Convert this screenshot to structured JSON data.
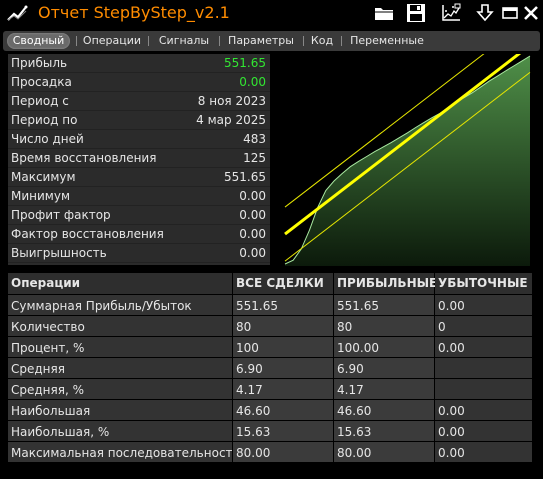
{
  "window": {
    "title": "Отчет StepByStep_v2.1",
    "icons": [
      "folder-icon",
      "save-icon",
      "chart-export-icon",
      "download-icon",
      "minimize-icon",
      "close-icon"
    ]
  },
  "tabs": [
    {
      "label": "Сводный",
      "active": true
    },
    {
      "label": "Операции",
      "active": false
    },
    {
      "label": "Сигналы",
      "active": false
    },
    {
      "label": "Параметры",
      "active": false
    },
    {
      "label": "Код",
      "active": false
    },
    {
      "label": "Переменные",
      "active": false
    }
  ],
  "stats": [
    {
      "label": "Прибыль",
      "value": "551.65",
      "color": "#32e632"
    },
    {
      "label": "Просадка",
      "value": "0.00",
      "color": "#32e632"
    },
    {
      "label": "Период с",
      "value": "8 ноя 2023"
    },
    {
      "label": "Период по",
      "value": "4 мар 2025"
    },
    {
      "label": "Число дней",
      "value": "483"
    },
    {
      "label": "Время восстановления",
      "value": "125"
    },
    {
      "label": "Максимум",
      "value": "551.65"
    },
    {
      "label": "Минимум",
      "value": "0.00"
    },
    {
      "label": "Профит фактор",
      "value": "0.00"
    },
    {
      "label": "Фактор восстановления",
      "value": "0.00"
    },
    {
      "label": "Выигрышность",
      "value": "0.00"
    }
  ],
  "table": {
    "headers": [
      "Операции",
      "ВСЕ СДЕЛКИ",
      "ПРИБЫЛЬНЫЕ",
      "УБЫТОЧНЫЕ"
    ],
    "rows": [
      [
        "Суммарная Прибыль/Убыток",
        "551.65",
        "551.65",
        "0.00"
      ],
      [
        "Количество",
        "80",
        "80",
        "0"
      ],
      [
        "Процент, %",
        "100",
        "100.00",
        "0.00"
      ],
      [
        "Средняя",
        "6.90",
        "6.90",
        ""
      ],
      [
        "Средняя, %",
        "4.17",
        "4.17",
        ""
      ],
      [
        "Наибольшая",
        "46.60",
        "46.60",
        "0.00"
      ],
      [
        "Наибольшая, %",
        "15.63",
        "15.63",
        "0.00"
      ],
      [
        "Максимальная последовательность",
        "80.00",
        "80.00",
        "0.00"
      ]
    ]
  },
  "chart_data": {
    "type": "area",
    "series": [
      {
        "values": [
          0,
          10,
          40,
          90,
          150,
          195,
          220,
          240,
          258,
          272,
          285,
          298,
          310,
          322,
          335,
          348,
          362,
          375,
          388,
          400,
          415,
          430,
          442,
          455,
          470,
          485,
          498,
          512,
          525,
          538,
          551.65
        ]
      }
    ],
    "trend_line": true,
    "bands": true,
    "colors": {
      "fill": "#3f7a3a",
      "line": "#9be39b",
      "trend": "#ffff00"
    }
  }
}
